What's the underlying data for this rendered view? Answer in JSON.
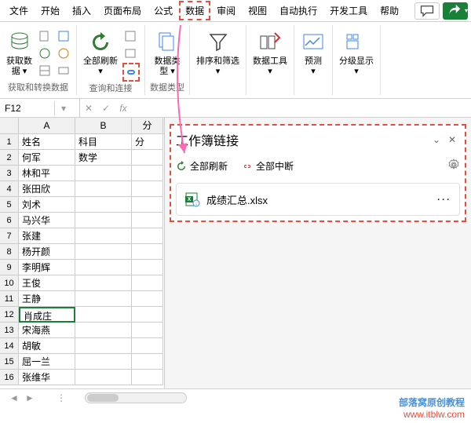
{
  "menu": {
    "items": [
      "文件",
      "开始",
      "插入",
      "页面布局",
      "公式",
      "数据",
      "审阅",
      "视图",
      "自动执行",
      "开发工具",
      "帮助"
    ],
    "highlighted_index": 5
  },
  "ribbon": {
    "groups": [
      {
        "label": "获取和转换数据",
        "big": {
          "label": "获取数\n据 ▾"
        }
      },
      {
        "label": "查询和连接",
        "big": {
          "label": "全部刷新\n▾"
        }
      },
      {
        "label": "数据类型",
        "big": {
          "label": "数据类\n型 ▾"
        }
      },
      {
        "label": "",
        "big": {
          "label": "排序和筛选\n▾"
        }
      },
      {
        "label": "",
        "big": {
          "label": "数据工具\n▾"
        }
      },
      {
        "label": "",
        "big": {
          "label": "预测\n▾"
        }
      },
      {
        "label": "",
        "big": {
          "label": "分级显示\n▾"
        }
      }
    ]
  },
  "formula_bar": {
    "name_box": "F12",
    "fx": "fx"
  },
  "grid": {
    "columns": [
      "A",
      "B",
      "分"
    ],
    "col_c_partial": "分",
    "rows": [
      {
        "n": 1,
        "a": "姓名",
        "b": "科目",
        "c": "分"
      },
      {
        "n": 2,
        "a": "何军",
        "b": "数学",
        "c": ""
      },
      {
        "n": 3,
        "a": "林和平",
        "b": "",
        "c": ""
      },
      {
        "n": 4,
        "a": "张田欣",
        "b": "",
        "c": ""
      },
      {
        "n": 5,
        "a": "刘术",
        "b": "",
        "c": ""
      },
      {
        "n": 6,
        "a": "马兴华",
        "b": "",
        "c": ""
      },
      {
        "n": 7,
        "a": "张建",
        "b": "",
        "c": ""
      },
      {
        "n": 8,
        "a": "杨开颜",
        "b": "",
        "c": ""
      },
      {
        "n": 9,
        "a": "李明辉",
        "b": "",
        "c": ""
      },
      {
        "n": 10,
        "a": "王俊",
        "b": "",
        "c": ""
      },
      {
        "n": 11,
        "a": "王静",
        "b": "",
        "c": ""
      },
      {
        "n": 12,
        "a": "肖成庄",
        "b": "",
        "c": ""
      },
      {
        "n": 13,
        "a": "宋海燕",
        "b": "",
        "c": ""
      },
      {
        "n": 14,
        "a": "胡敏",
        "b": "",
        "c": ""
      },
      {
        "n": 15,
        "a": "屈一兰",
        "b": "",
        "c": ""
      },
      {
        "n": 16,
        "a": "张维华",
        "b": "",
        "c": ""
      }
    ],
    "selected_row": 12
  },
  "pane": {
    "title": "工作簿链接",
    "refresh_all": "全部刷新",
    "break_all": "全部中断",
    "link": {
      "name": "成绩汇总.xlsx"
    }
  },
  "watermark": {
    "line1": "部落窝原创教程",
    "line2": "www.itblw.com"
  }
}
